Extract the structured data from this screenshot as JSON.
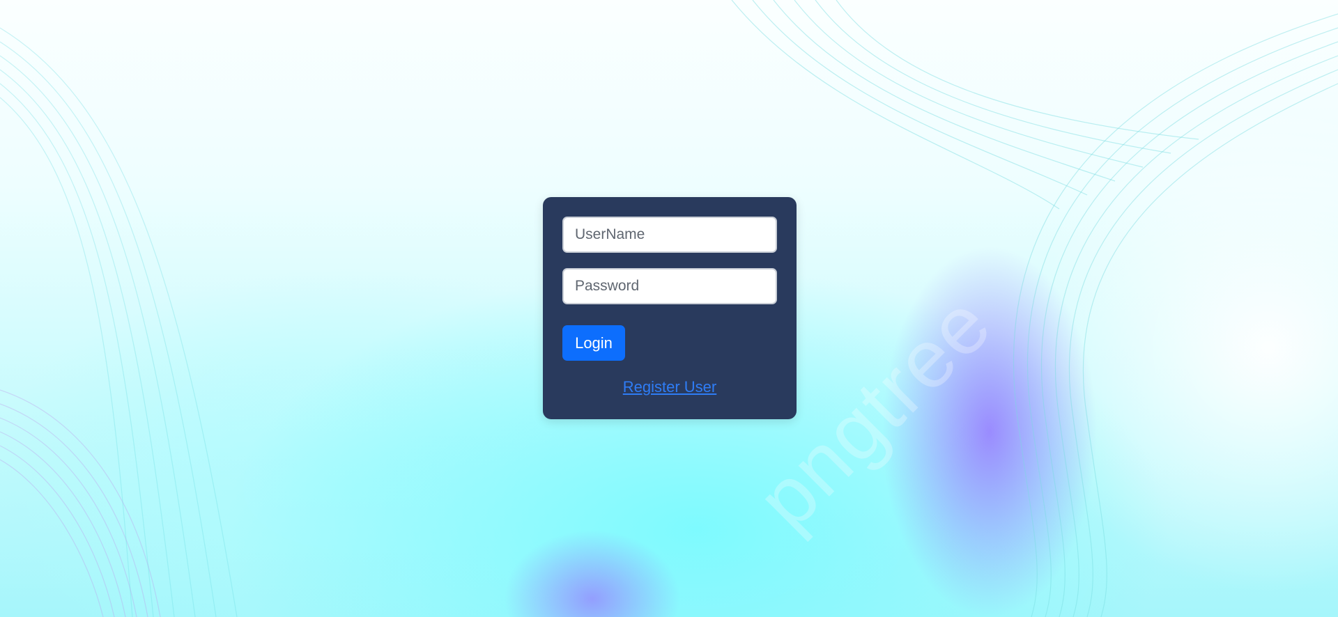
{
  "login_form": {
    "username_placeholder": "UserName",
    "password_placeholder": "Password",
    "login_label": "Login",
    "register_label": "Register User"
  },
  "background": {
    "watermark_text": "pngtree"
  },
  "colors": {
    "card": "#293a5d",
    "primary_button": "#0d6efd",
    "link": "#2f7df6"
  }
}
